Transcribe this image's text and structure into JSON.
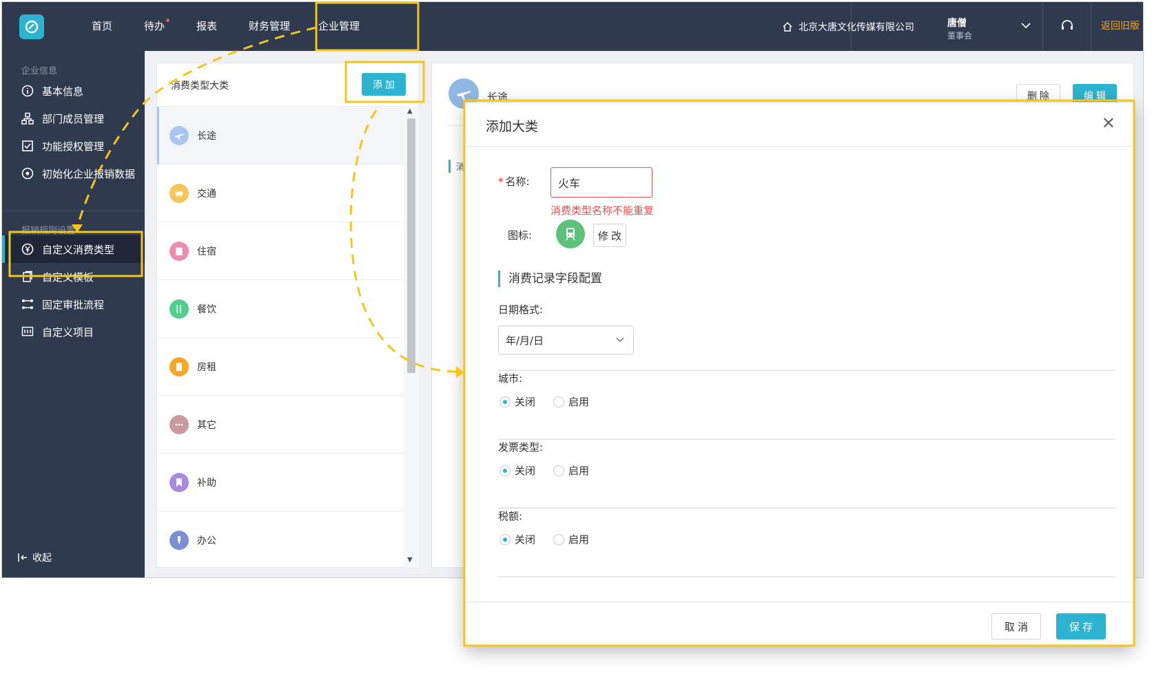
{
  "topbar": {
    "nav": [
      {
        "label": "首页"
      },
      {
        "label": "待办"
      },
      {
        "label": "报表"
      },
      {
        "label": "财务管理"
      },
      {
        "label": "企业管理"
      }
    ],
    "company": "北京大唐文化传媒有限公司",
    "user_name": "唐僧",
    "user_role": "董事会",
    "back_old": "返回旧版"
  },
  "sidebar": {
    "group1": "企业信息",
    "items1": [
      {
        "label": "基本信息",
        "icon": "info-icon"
      },
      {
        "label": "部门成员管理",
        "icon": "org-icon"
      },
      {
        "label": "功能授权管理",
        "icon": "checkbox-icon"
      },
      {
        "label": "初始化企业报销数据",
        "icon": "target-icon"
      }
    ],
    "group2": "报销规则设置",
    "items2": [
      {
        "label": "自定义消费类型",
        "icon": "yen-icon"
      },
      {
        "label": "自定义模板",
        "icon": "template-icon"
      },
      {
        "label": "固定审批流程",
        "icon": "flow-icon"
      },
      {
        "label": "自定义项目",
        "icon": "project-icon"
      }
    ],
    "collapse": "收起"
  },
  "categories": {
    "title": "消费类型大类",
    "add_label": "添 加",
    "items": [
      {
        "label": "长途",
        "color": "#a9c6ee",
        "icon": "plane-icon"
      },
      {
        "label": "交通",
        "color": "#f7c55a",
        "icon": "car-icon"
      },
      {
        "label": "住宿",
        "color": "#f08ab0",
        "icon": "building-icon"
      },
      {
        "label": "餐饮",
        "color": "#4fcf8a",
        "icon": "fork-knife-icon"
      },
      {
        "label": "房租",
        "color": "#f5a623",
        "icon": "receipt-icon"
      },
      {
        "label": "其它",
        "color": "#c99a9f",
        "icon": "dots-icon"
      },
      {
        "label": "补助",
        "color": "#a78be3",
        "icon": "bookmark-icon"
      },
      {
        "label": "办公",
        "color": "#7a8fd6",
        "icon": "pin-icon"
      }
    ]
  },
  "detail": {
    "name": "长途",
    "delete_label": "删 除",
    "edit_label": "编 辑",
    "section_partial": "消"
  },
  "modal": {
    "title": "添加大类",
    "name_label": "名称:",
    "name_value": "火车",
    "name_error": "消费类型名称不能重复",
    "icon_label": "图标:",
    "modify_label": "修 改",
    "section_title": "消费记录字段配置",
    "date_label": "日期格式:",
    "date_value": "年/月/日",
    "city_label": "城市:",
    "invoice_label": "发票类型:",
    "tax_label": "税额:",
    "off_label": "关闭",
    "on_label": "启用",
    "cancel_label": "取 消",
    "save_label": "保 存"
  },
  "colors": {
    "accent": "#2bb3cf",
    "dark_nav": "#2f3a4f",
    "highlight": "#f5c518",
    "error": "#f04e4e"
  }
}
